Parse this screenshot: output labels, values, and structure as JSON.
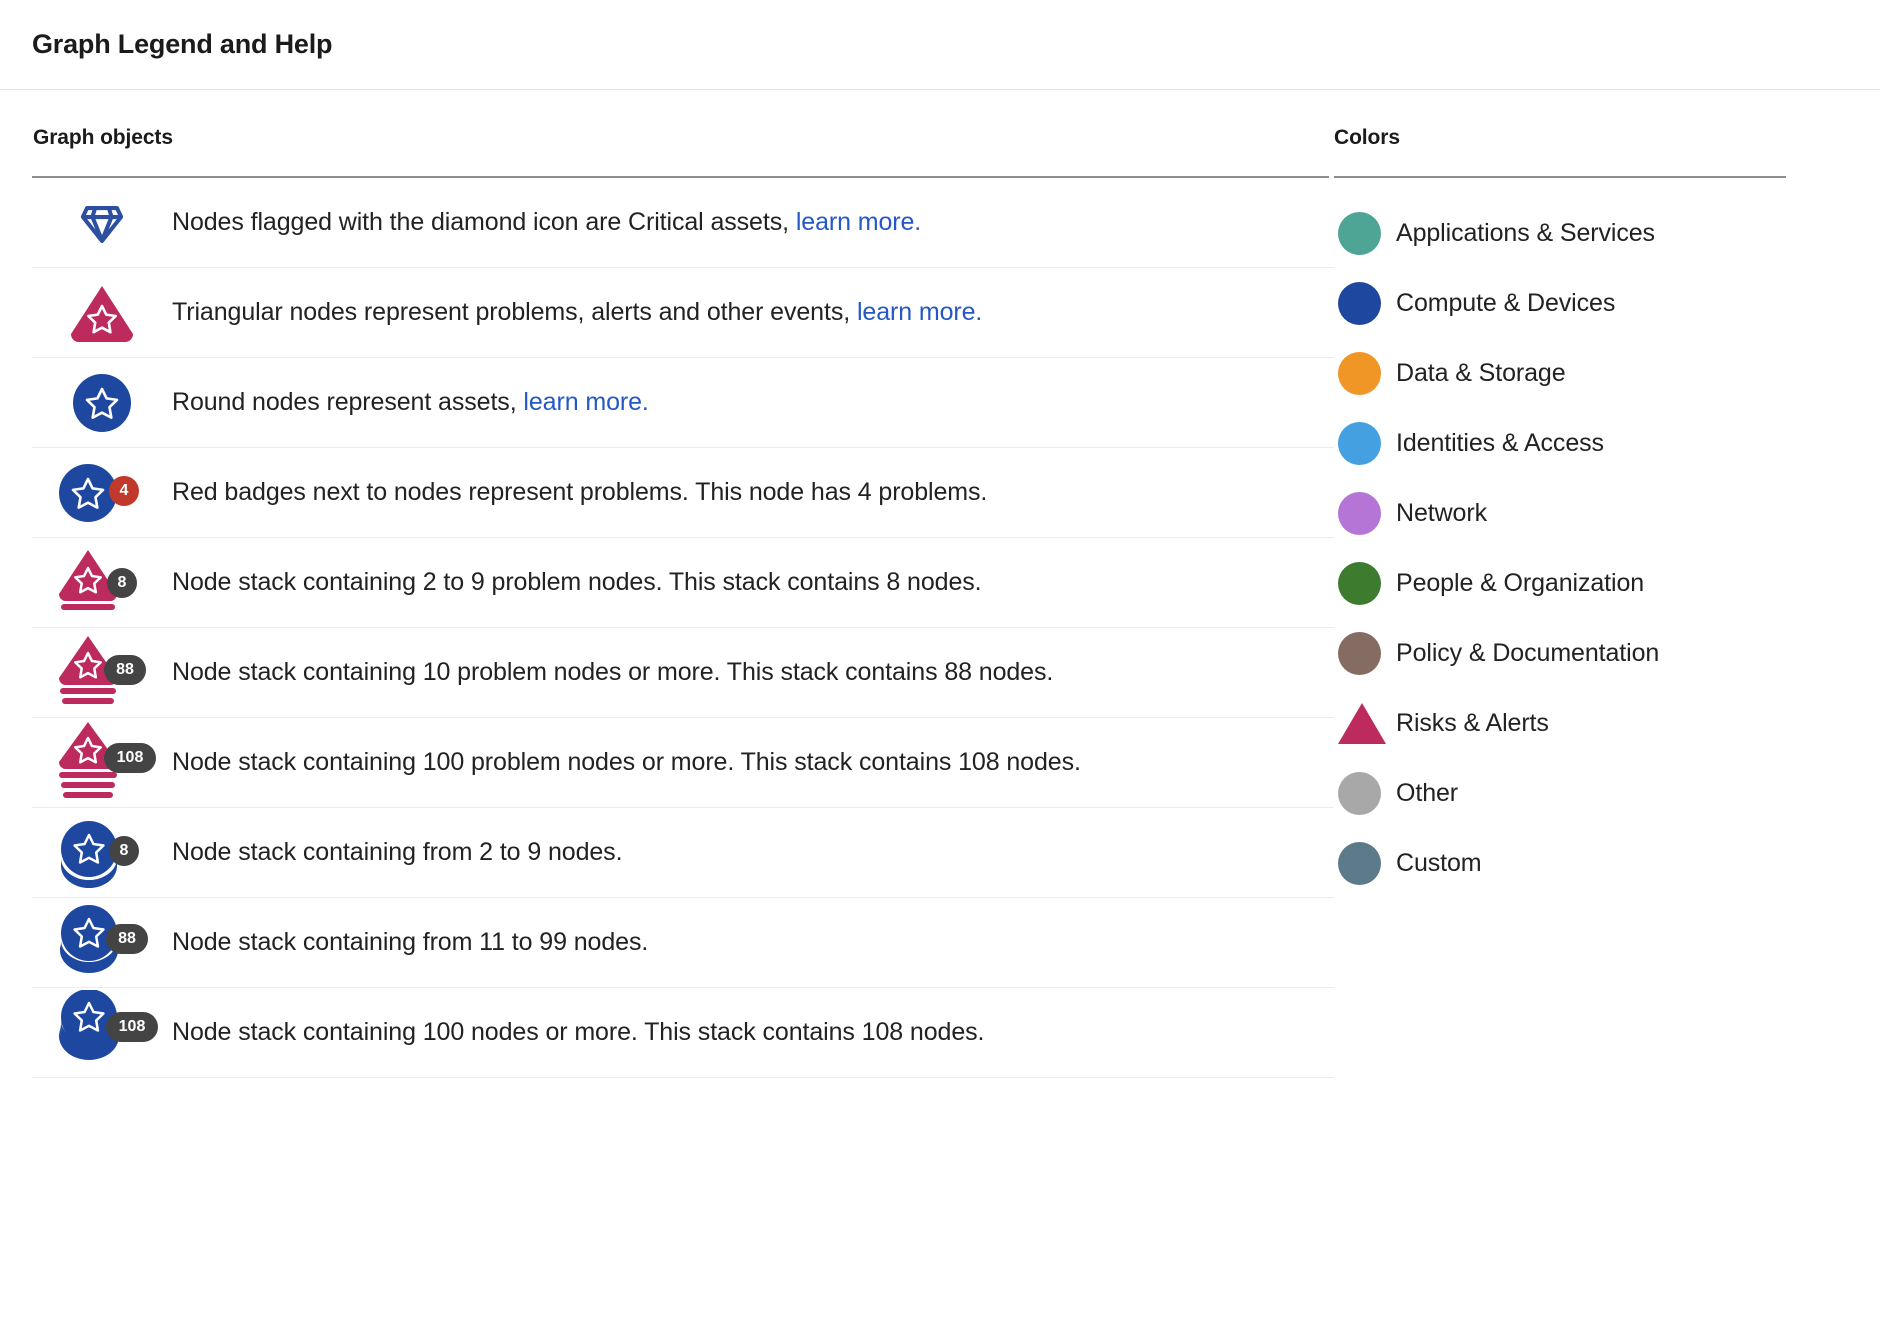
{
  "header": {
    "title": "Graph Legend and Help"
  },
  "objects": {
    "section_title": "Graph objects",
    "rows": [
      {
        "icon": "critical-asset-diamond-icon",
        "text_before": "Nodes flagged with the diamond icon are Critical assets,",
        "link": "learn more.",
        "text_after": ""
      },
      {
        "icon": "problem-triangle-node-icon",
        "text_before": "Triangular nodes represent problems, alerts and other events,",
        "link": "learn more.",
        "text_after": ""
      },
      {
        "icon": "asset-round-node-icon",
        "text_before": "Round nodes represent assets,",
        "link": "learn more.",
        "text_after": ""
      },
      {
        "icon": "round-node-with-red-badge-icon",
        "text_before": "Red badges next to nodes represent problems. This node has 4 problems.",
        "link": "",
        "text_after": "",
        "badge": "4"
      },
      {
        "icon": "triangle-stack-small-icon",
        "text_before": "Node stack containing 2 to 9 problem nodes. This stack contains 8 nodes.",
        "link": "",
        "text_after": "",
        "badge": "8"
      },
      {
        "icon": "triangle-stack-medium-icon",
        "text_before": "Node stack containing 10 problem nodes or more. This stack contains 88 nodes.",
        "link": "",
        "text_after": "",
        "badge": "88"
      },
      {
        "icon": "triangle-stack-large-icon",
        "text_before": "Node stack containing 100 problem nodes or more. This stack contains 108 nodes.",
        "link": "",
        "text_after": "",
        "badge": "108"
      },
      {
        "icon": "circle-stack-small-icon",
        "text_before": "Node stack containing from 2 to 9 nodes.",
        "link": "",
        "text_after": "",
        "badge": "8"
      },
      {
        "icon": "circle-stack-medium-icon",
        "text_before": "Node stack containing from 11 to 99 nodes.",
        "link": "",
        "text_after": "",
        "badge": "88"
      },
      {
        "icon": "circle-stack-large-icon",
        "text_before": "Node stack containing 100 nodes or more. This stack contains 108 nodes.",
        "link": "",
        "text_after": "",
        "badge": "108"
      }
    ]
  },
  "colors": {
    "section_title": "Colors",
    "items": [
      {
        "label": "Applications & Services",
        "color": "#4fa595",
        "shape": "circle"
      },
      {
        "label": "Compute & Devices",
        "color": "#1e48a0",
        "shape": "circle"
      },
      {
        "label": "Data & Storage",
        "color": "#ef9626",
        "shape": "circle"
      },
      {
        "label": "Identities & Access",
        "color": "#44a0e0",
        "shape": "circle"
      },
      {
        "label": "Network",
        "color": "#b475d6",
        "shape": "circle"
      },
      {
        "label": "People & Organization",
        "color": "#3d7c2e",
        "shape": "circle"
      },
      {
        "label": "Policy & Documentation",
        "color": "#856c63",
        "shape": "circle"
      },
      {
        "label": "Risks & Alerts",
        "color": "#bc2a5e",
        "shape": "triangle"
      },
      {
        "label": "Other",
        "color": "#a8a8a8",
        "shape": "circle"
      },
      {
        "label": "Custom",
        "color": "#5d7a8a",
        "shape": "circle"
      }
    ]
  },
  "palette": {
    "node_blue": "#1e48a0",
    "node_crimson": "#bc2a5e",
    "badge_red": "#c0392b",
    "badge_grey": "#444444",
    "link_blue": "#2458c4"
  }
}
